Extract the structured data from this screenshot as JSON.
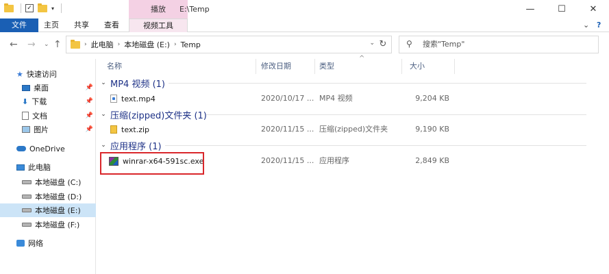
{
  "window": {
    "context_tab_header": "播放",
    "path_title": "E:\\Temp",
    "buttons": {
      "minimize": "—",
      "maximize": "☐",
      "close": "✕"
    }
  },
  "ribbon": {
    "tabs": [
      "文件",
      "主页",
      "共享",
      "查看",
      "视频工具"
    ],
    "collapse": "⌄",
    "help": "?"
  },
  "address": {
    "breadcrumb": [
      "此电脑",
      "本地磁盘 (E:)",
      "Temp"
    ],
    "search_placeholder": "搜索\"Temp\""
  },
  "nav": {
    "quick_access": "快速访问",
    "quick_items": [
      "桌面",
      "下载",
      "文档",
      "图片"
    ],
    "onedrive": "OneDrive",
    "this_pc": "此电脑",
    "drives": [
      "本地磁盘 (C:)",
      "本地磁盘 (D:)",
      "本地磁盘 (E:)",
      "本地磁盘 (F:)"
    ],
    "network": "网络"
  },
  "columns": {
    "name": "名称",
    "date": "修改日期",
    "type": "类型",
    "size": "大小"
  },
  "groups": [
    {
      "title": "MP4 视频 (1)",
      "files": [
        {
          "name": "text.mp4",
          "date": "2020/10/17 ...",
          "type": "MP4 视频",
          "size": "9,204 KB"
        }
      ]
    },
    {
      "title": "压缩(zipped)文件夹 (1)",
      "files": [
        {
          "name": "text.zip",
          "date": "2020/11/15 ...",
          "type": "压缩(zipped)文件夹",
          "size": "9,190 KB"
        }
      ]
    },
    {
      "title": "应用程序 (1)",
      "files": [
        {
          "name": "winrar-x64-591sc.exe",
          "date": "2020/11/15 ...",
          "type": "应用程序",
          "size": "2,849 KB"
        }
      ]
    }
  ],
  "colors": {
    "file_tab": "#1a5fb4",
    "context_tab": "#f4d1e4",
    "group_title": "#1e3287",
    "highlight_box": "#d9262a",
    "nav_selected": "#cce4f7"
  }
}
